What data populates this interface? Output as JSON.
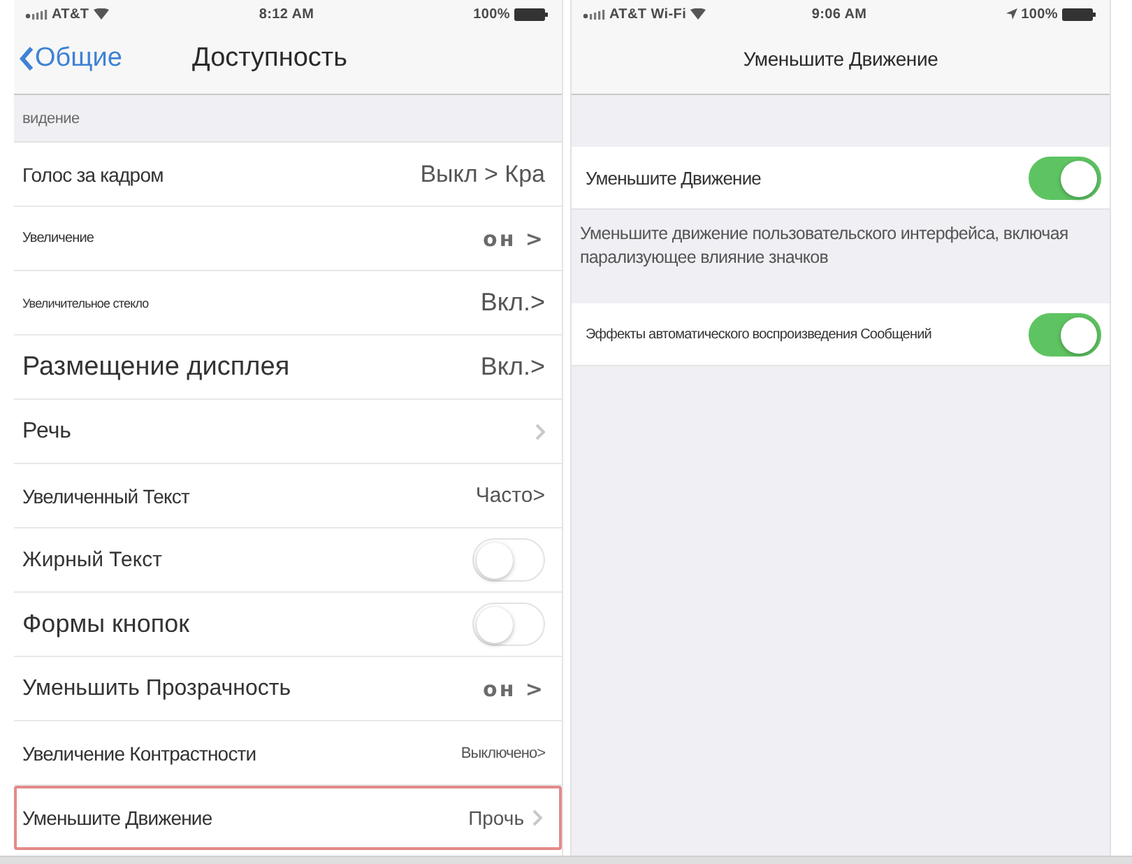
{
  "left_screen": {
    "status_bar": {
      "carrier": "AT&T",
      "time": "8:12 AM",
      "battery": "100%"
    },
    "nav_bar": {
      "back": "Общие",
      "title": "Доступность"
    },
    "section_header": "видение",
    "rows": [
      {
        "label": "Голос за кадром",
        "kind": "value",
        "value": "Выкл > Кра",
        "highlighted": false
      },
      {
        "label": "Увеличение",
        "kind": "value",
        "value": "он >",
        "highlighted": false
      },
      {
        "label": "Увеличительное стекло",
        "kind": "value",
        "value": "Вкл.>",
        "highlighted": false
      },
      {
        "label": "Размещение дисплея",
        "kind": "value",
        "value": "Вкл.>",
        "highlighted": false
      },
      {
        "label": "Речь",
        "kind": "link",
        "highlighted": false
      },
      {
        "label": "Увеличенный Текст",
        "kind": "value",
        "value": "Часто>",
        "highlighted": false
      },
      {
        "label": "Жирный Текст",
        "kind": "toggle",
        "on": false,
        "highlighted": false
      },
      {
        "label": "Формы кнопок",
        "kind": "toggle",
        "on": false,
        "highlighted": false
      },
      {
        "label": "Уменьшить Прозрачность",
        "kind": "value",
        "value": "он >",
        "highlighted": false
      },
      {
        "label": "Увеличение Контрастности",
        "kind": "value",
        "value": "Выключено>",
        "highlighted": false
      },
      {
        "label": "Уменьшите Движение",
        "kind": "value_link",
        "value": "Прочь",
        "highlighted": true
      }
    ]
  },
  "right_screen": {
    "status_bar": {
      "carrier": "AT&T Wi-Fi",
      "time": "9:06 AM",
      "battery": "100%"
    },
    "nav_bar": {
      "title": "Уменьшите Движение"
    },
    "groups": [
      {
        "rows": [
          {
            "label": "Уменьшите Движение",
            "on": true
          }
        ],
        "footer": "Уменьшите движение пользовательского интерфейса, включая парализующее влияние значков"
      },
      {
        "rows": [
          {
            "label": "Эффекты автоматического воспроизведения Сообщений",
            "on": true
          }
        ]
      }
    ]
  }
}
